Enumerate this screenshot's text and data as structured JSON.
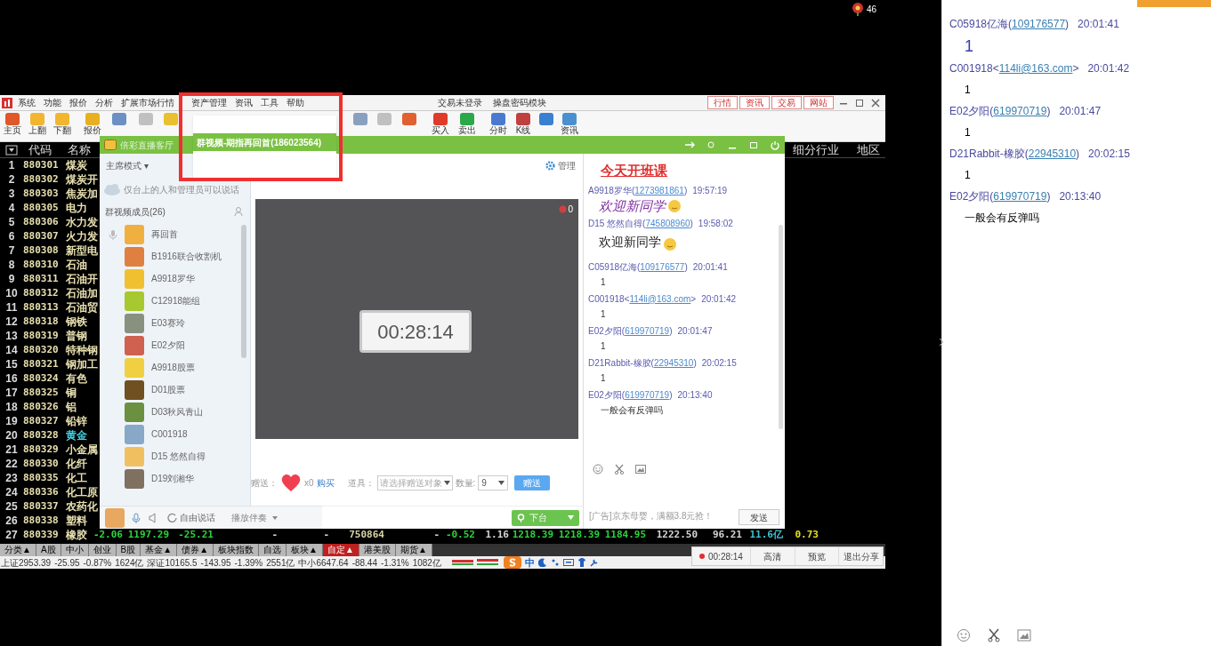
{
  "recorder": {
    "count": "46"
  },
  "app": {
    "menu": [
      "系统",
      "功能",
      "报价",
      "分析",
      "扩展市场行情",
      "资产管理",
      "资讯",
      "工具",
      "帮助"
    ],
    "menu_right": [
      "交易未登录",
      "操盘密码模块"
    ],
    "top_tabs": [
      "行情",
      "资讯",
      "交易",
      "网站"
    ],
    "toolbar": [
      {
        "kind": "button",
        "label": "主页"
      },
      {
        "kind": "button",
        "label": "上翻"
      },
      {
        "kind": "button",
        "label": "下翻"
      },
      {
        "kind": "button",
        "label": "报价"
      },
      {
        "kind": "icon"
      },
      {
        "kind": "icon"
      },
      {
        "kind": "icon"
      },
      {
        "kind": "icon"
      },
      {
        "kind": "icon"
      },
      {
        "kind": "icon"
      },
      {
        "kind": "button",
        "label": "买入"
      },
      {
        "kind": "button",
        "label": "卖出"
      },
      {
        "kind": "button",
        "label": "分时"
      },
      {
        "kind": "button",
        "label": "K线"
      },
      {
        "kind": "icon"
      },
      {
        "kind": "button",
        "label": "资讯"
      }
    ],
    "table": {
      "columns": [
        "代码",
        "名称"
      ],
      "columns_right": [
        "细分行业",
        "地区"
      ],
      "rows": [
        {
          "no": "1",
          "code": "880301",
          "name": "煤炭",
          "highlighted": false
        },
        {
          "no": "2",
          "code": "880302",
          "name": "煤炭开",
          "highlighted": false
        },
        {
          "no": "3",
          "code": "880303",
          "name": "焦炭加",
          "highlighted": false
        },
        {
          "no": "4",
          "code": "880305",
          "name": "电力",
          "highlighted": false
        },
        {
          "no": "5",
          "code": "880306",
          "name": "水力发",
          "highlighted": false
        },
        {
          "no": "6",
          "code": "880307",
          "name": "火力发",
          "highlighted": false
        },
        {
          "no": "7",
          "code": "880308",
          "name": "新型电",
          "highlighted": false
        },
        {
          "no": "8",
          "code": "880310",
          "name": "石油",
          "highlighted": false
        },
        {
          "no": "9",
          "code": "880311",
          "name": "石油开",
          "highlighted": false
        },
        {
          "no": "10",
          "code": "880312",
          "name": "石油加",
          "highlighted": false
        },
        {
          "no": "11",
          "code": "880313",
          "name": "石油贸",
          "highlighted": false
        },
        {
          "no": "12",
          "code": "880318",
          "name": "钢铁",
          "highlighted": false
        },
        {
          "no": "13",
          "code": "880319",
          "name": "普钢",
          "highlighted": false
        },
        {
          "no": "14",
          "code": "880320",
          "name": "特种钢",
          "highlighted": false
        },
        {
          "no": "15",
          "code": "880321",
          "name": "钢加工",
          "highlighted": false
        },
        {
          "no": "16",
          "code": "880324",
          "name": "有色",
          "highlighted": false
        },
        {
          "no": "17",
          "code": "880325",
          "name": "铜",
          "highlighted": false
        },
        {
          "no": "18",
          "code": "880326",
          "name": "铝",
          "highlighted": false
        },
        {
          "no": "19",
          "code": "880327",
          "name": "铅锌",
          "highlighted": false
        },
        {
          "no": "20",
          "code": "880328",
          "name": "黄金",
          "highlighted": true
        },
        {
          "no": "21",
          "code": "880329",
          "name": "小金属",
          "highlighted": false
        },
        {
          "no": "22",
          "code": "880330",
          "name": "化纤",
          "highlighted": false
        },
        {
          "no": "23",
          "code": "880335",
          "name": "化工",
          "highlighted": false
        },
        {
          "no": "24",
          "code": "880336",
          "name": "化工原",
          "highlighted": false
        },
        {
          "no": "25",
          "code": "880337",
          "name": "农药化",
          "highlighted": false
        },
        {
          "no": "26",
          "code": "880338",
          "name": "塑料",
          "highlighted": false
        },
        {
          "no": "27",
          "code": "880339",
          "name": "橡胶",
          "highlighted": false
        }
      ],
      "last_row_values": [
        {
          "text": "-2.06",
          "kind": "down"
        },
        {
          "text": "1197.29",
          "kind": "down"
        },
        {
          "text": "-25.21",
          "kind": "down"
        },
        {
          "text": "-",
          "kind": "plain"
        },
        {
          "text": "-",
          "kind": "plain"
        },
        {
          "text": "750864",
          "kind": "volume"
        },
        {
          "text": "-",
          "kind": "plain"
        },
        {
          "text": "-0.52",
          "kind": "down"
        },
        {
          "text": "1.16",
          "kind": "plain"
        },
        {
          "text": "1218.39",
          "kind": "down"
        },
        {
          "text": "1218.39",
          "kind": "down"
        },
        {
          "text": "1184.95",
          "kind": "down"
        },
        {
          "text": "1222.50",
          "kind": "plain"
        },
        {
          "text": "96.21",
          "kind": "plain"
        },
        {
          "text": "11.6亿",
          "kind": "amount"
        },
        {
          "text": "0.73",
          "kind": "ratio"
        }
      ]
    },
    "bottom_tabs": [
      {
        "label": "分类▲",
        "selected": false
      },
      {
        "label": "A股",
        "selected": false
      },
      {
        "label": "中小",
        "selected": false
      },
      {
        "label": "创业",
        "selected": false
      },
      {
        "label": "B股",
        "selected": false
      },
      {
        "label": "基金▲",
        "selected": false
      },
      {
        "label": "债券▲",
        "selected": false
      },
      {
        "label": "板块指数",
        "selected": false
      },
      {
        "label": "自选",
        "selected": false
      },
      {
        "label": "板块▲",
        "selected": false
      },
      {
        "label": "自定▲",
        "selected": true
      },
      {
        "label": "港美股",
        "selected": false
      },
      {
        "label": "期货▲",
        "selected": false
      }
    ],
    "status": [
      "上证2953.39",
      "-25.95",
      "-0.87%",
      "1624亿",
      "深证10165.5",
      "-143.95",
      "-1.39%",
      "2551亿",
      "中小6647.64",
      "-88.44",
      "-1.31%",
      "1082亿"
    ],
    "ime": [
      "中"
    ]
  },
  "group_window": {
    "tab": "倍彩直播客厅",
    "popup_title": "群视频-期指再回首(186023564)",
    "mode": "主席模式 ▾",
    "notice": "仅台上的人和管理员可以说话",
    "members_title": "群视频成员(26)",
    "members": [
      "再回首",
      "B1916联合收割机",
      "A9918罗华",
      "C12918能组",
      "E03赛玲",
      "E02夕阳",
      "A9918股票",
      "D01股票",
      "D03秋风青山",
      "C001918",
      "D15 悠然自得",
      "D19刘湘华"
    ],
    "manage": "管理",
    "badge": "0",
    "timer": "00:28:14",
    "gift": {
      "label": "赠送：",
      "count": "x0",
      "buy": "购买",
      "prop_label": "道具：",
      "prop_placeholder": "请选择赠送对象",
      "qty_label": "数量:",
      "qty": "9",
      "send": "赠送"
    },
    "bottom": {
      "talk": "自由说话",
      "music": "播放伴奏",
      "stage": "下台"
    },
    "chat_title": "今天开班课",
    "messages": [
      {
        "prefix": "A9918罗华(",
        "link": "1273981861",
        "suffix": ")",
        "time": "19:57:19",
        "text": "欢迎新同学",
        "kind": "fancy",
        "emoji": true
      },
      {
        "prefix": "D15 悠然自得(",
        "link": "745808960",
        "suffix": ")",
        "time": "19:58:02",
        "text": "欢迎新同学",
        "kind": "large",
        "emoji": true
      },
      {
        "prefix": "C05918亿海(",
        "link": "109176577",
        "suffix": ")",
        "time": "20:01:41",
        "text": "1",
        "kind": "plain",
        "emoji": false
      },
      {
        "prefix": "C001918<",
        "link": "114li@163.com",
        "suffix": ">",
        "time": "20:01:42",
        "text": "1",
        "kind": "plain",
        "emoji": false
      },
      {
        "prefix": "E02夕阳(",
        "link": "619970719",
        "suffix": ")",
        "time": "20:01:47",
        "text": "1",
        "kind": "plain",
        "emoji": false
      },
      {
        "prefix": "D21Rabbit-橡胶(",
        "link": "22945310",
        "suffix": ")",
        "time": "20:02:15",
        "text": "1",
        "kind": "plain",
        "emoji": false
      },
      {
        "prefix": "E02夕阳(",
        "link": "619970719",
        "suffix": ")",
        "time": "20:13:40",
        "text": "一般会有反弹吗",
        "kind": "plain",
        "emoji": false
      }
    ],
    "ad": "[广告]京东母婴，满额3.8元抢！",
    "send": "发送"
  },
  "share_bar": {
    "time": "00:28:14",
    "buttons": [
      "高清",
      "预览",
      "退出分享"
    ]
  },
  "side_chat": [
    {
      "prefix": "C05918亿海(",
      "link": "109176577",
      "suffix": ")",
      "time": "20:01:41",
      "text": "1",
      "kind": "large"
    },
    {
      "prefix": "C001918<",
      "link": "114li@163.com",
      "suffix": ">",
      "time": "20:01:42",
      "text": "1",
      "kind": "plain"
    },
    {
      "prefix": "E02夕阳(",
      "link": "619970719",
      "suffix": ")",
      "time": "20:01:47",
      "text": "1",
      "kind": "plain"
    },
    {
      "prefix": "D21Rabbit-橡胶(",
      "link": "22945310",
      "suffix": ")",
      "time": "20:02:15",
      "text": "1",
      "kind": "plain"
    },
    {
      "prefix": "E02夕阳(",
      "link": "619970719",
      "suffix": ")",
      "time": "20:13:40",
      "text": "一般会有反弹吗",
      "kind": "plain"
    }
  ]
}
